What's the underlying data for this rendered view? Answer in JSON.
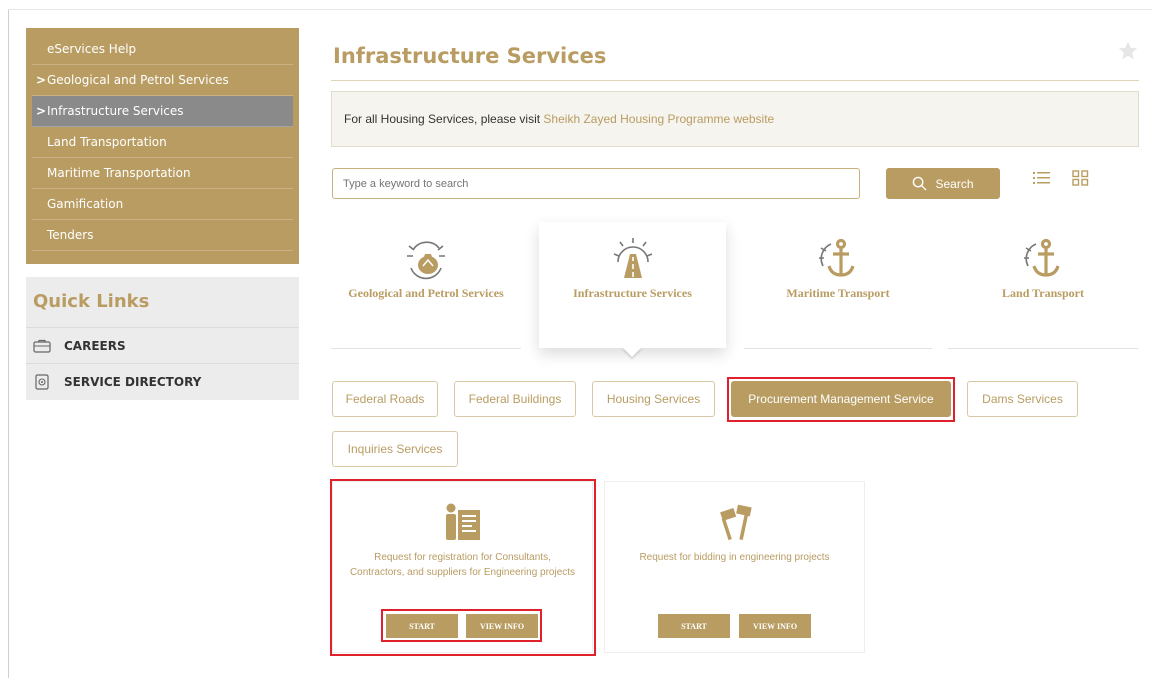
{
  "sidebar": {
    "items": [
      {
        "label": "eServices Help",
        "arrow": false,
        "active": false
      },
      {
        "label": "Geological and Petrol Services",
        "arrow": true,
        "active": false
      },
      {
        "label": "Infrastructure Services",
        "arrow": true,
        "active": true
      },
      {
        "label": "Land Transportation",
        "arrow": false,
        "active": false
      },
      {
        "label": "Maritime Transportation",
        "arrow": false,
        "active": false
      },
      {
        "label": "Gamification",
        "arrow": false,
        "active": false
      },
      {
        "label": "Tenders",
        "arrow": false,
        "active": false
      }
    ],
    "arrow_glyph": ">"
  },
  "quick_links": {
    "title": "Quick Links",
    "items": [
      {
        "label": "CAREERS",
        "icon": "briefcase-icon"
      },
      {
        "label": "SERVICE DIRECTORY",
        "icon": "directory-icon"
      }
    ]
  },
  "main": {
    "title": "Infrastructure Services",
    "notice_text": "For all Housing Services, please visit ",
    "notice_link": "Sheikh Zayed Housing Programme website",
    "search_placeholder": "Type a keyword to search",
    "search_button": "Search"
  },
  "categories": [
    {
      "label": "Geological and Petrol Services",
      "icon": "oil-gear-icon",
      "active": false
    },
    {
      "label": "Infrastructure Services",
      "icon": "road-gear-icon",
      "active": true
    },
    {
      "label": "Maritime Transport",
      "icon": "anchor-gear-icon",
      "active": false
    },
    {
      "label": "Land Transport",
      "icon": "anchor-gear-icon",
      "active": false
    }
  ],
  "tabs": [
    {
      "label": "Federal Roads",
      "selected": false
    },
    {
      "label": "Federal Buildings",
      "selected": false
    },
    {
      "label": "Housing Services",
      "selected": false
    },
    {
      "label": "Procurement Management Service",
      "selected": true
    },
    {
      "label": "Dams Services",
      "selected": false
    },
    {
      "label": "Inquiries Services",
      "selected": false
    }
  ],
  "services": [
    {
      "title": "Request for registration for Consultants, Contractors, and suppliers for Engineering projects",
      "icon": "registration-icon",
      "start": "START",
      "info": "VIEW INFO"
    },
    {
      "title": "Request for bidding in engineering projects",
      "icon": "bidding-icon",
      "start": "START",
      "info": "VIEW INFO"
    }
  ],
  "colors": {
    "accent": "#b99c62",
    "active_nav": "#8a8a8a",
    "highlight": "#e0202a"
  }
}
